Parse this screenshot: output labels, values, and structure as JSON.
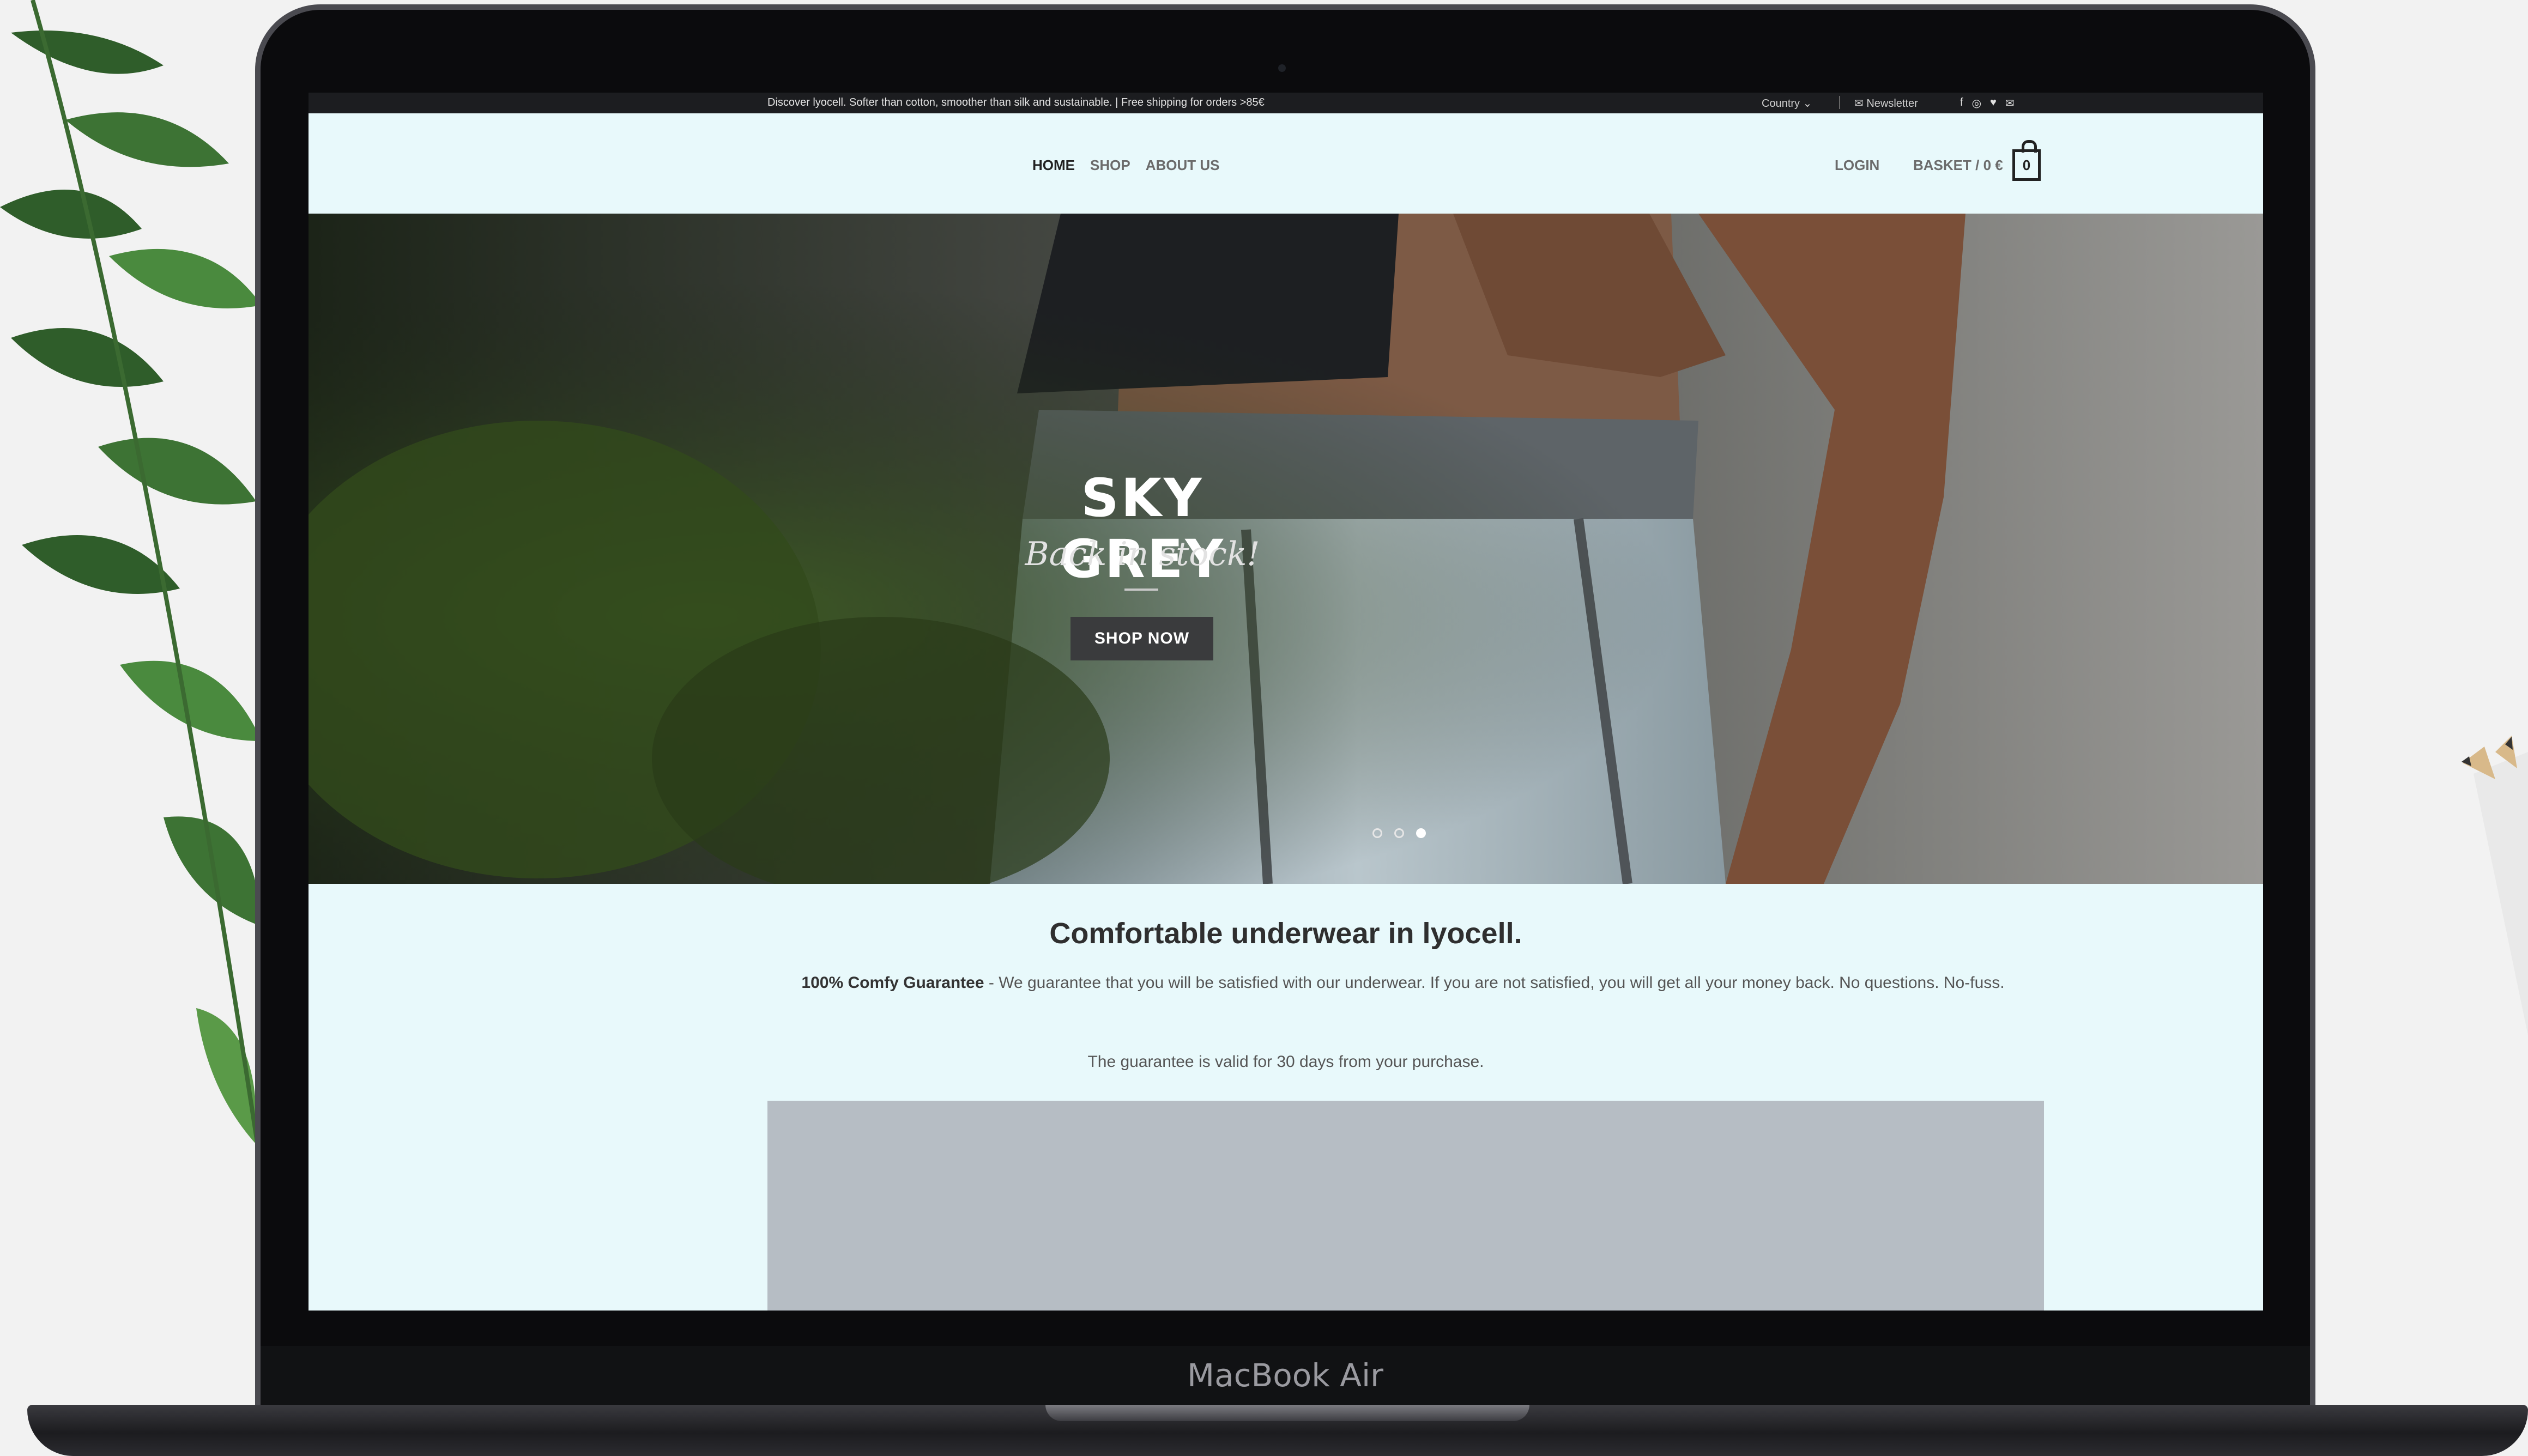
{
  "device": {
    "brand_label": "MacBook Air"
  },
  "topbar": {
    "promo": "Discover lyocell. Softer than cotton, smoother than silk and sustainable. | Free shipping for orders >85€",
    "country_label": "Country",
    "newsletter_label": "Newsletter",
    "social_icons": [
      "facebook-icon",
      "instagram-icon",
      "twitter-icon",
      "mail-icon"
    ]
  },
  "nav": {
    "items": [
      {
        "label": "HOME",
        "active": true
      },
      {
        "label": "SHOP",
        "active": false
      },
      {
        "label": "ABOUT US",
        "active": false
      }
    ],
    "login": "LOGIN",
    "basket": "BASKET / 0 €",
    "basket_count": "0"
  },
  "hero": {
    "title": "SKY GREY",
    "subtitle": "Back in stock!",
    "cta": "SHOP NOW",
    "slides_total": 3,
    "active_slide": 3
  },
  "content": {
    "title": "Comfortable underwear in lyocell.",
    "guarantee_bold": "100% Comfy Guarantee",
    "guarantee_text": " - We guarantee that you will be satisfied with our underwear. If you are not satisfied, you will get all your money back. No questions. No-fuss.",
    "validity": "The guarantee is valid for 30 days from your purchase."
  },
  "colors": {
    "page_bg": "#e8f9fb",
    "topbar_bg": "#1c1d20",
    "button_bg": "#3a3b3d",
    "media_placeholder": "#b6bdc4"
  }
}
